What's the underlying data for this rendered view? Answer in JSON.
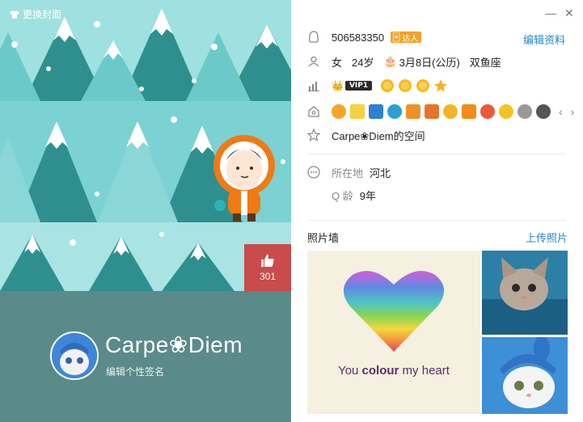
{
  "cover": {
    "change_label": "更换封面"
  },
  "likes": {
    "count": "301"
  },
  "profile": {
    "nickname": "Carpe❀Diem",
    "signature": "编辑个性签名"
  },
  "info": {
    "qq_number": "506583350",
    "talent_label": "达人",
    "edit_label": "编辑资料",
    "gender": "女",
    "age": "24岁",
    "birthday": "3月8日(公历)",
    "zodiac": "双鱼座",
    "vip_label": "VIP1",
    "space_link": "Carpe❀Diem的空间",
    "location_label": "所在地",
    "location_value": "河北",
    "qage_label": "Q 龄",
    "qage_value": "9年"
  },
  "photos": {
    "title": "照片墙",
    "upload_label": "上传照片",
    "caption_prefix": "You ",
    "caption_bold": "colour",
    "caption_suffix": " my heart"
  },
  "window": {
    "minimize_icon": "minimize-icon",
    "close_icon": "close-icon"
  },
  "colors": {
    "accent_link": "#1f86c9",
    "like_bg": "#c94b4b",
    "profile_bar": "#5b8a8a",
    "scene_bg": "#9fe0e0"
  }
}
